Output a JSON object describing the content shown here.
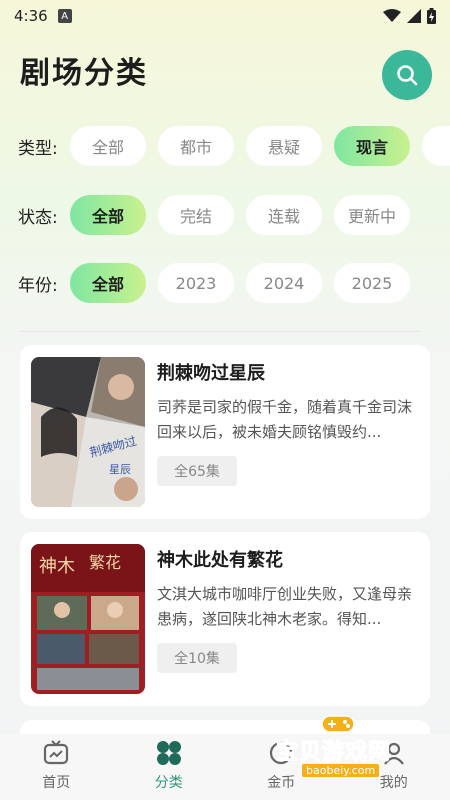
{
  "status_bar": {
    "time": "4:36",
    "badge": "A"
  },
  "header": {
    "title": "剧场分类"
  },
  "filters": {
    "type": {
      "label": "类型:",
      "options": [
        "全部",
        "都市",
        "悬疑",
        "现言"
      ],
      "selected": "现言"
    },
    "status": {
      "label": "状态:",
      "options": [
        "全部",
        "完结",
        "连载",
        "更新中"
      ],
      "selected": "全部"
    },
    "year": {
      "label": "年份:",
      "options": [
        "全部",
        "2023",
        "2024",
        "2025"
      ],
      "selected": "全部"
    }
  },
  "dramas": [
    {
      "title": "荆棘吻过星辰",
      "description": "司荞是司家的假千金，随着真千金司沫回来以后，被未婚夫顾铭慎毁约...",
      "episodes": "全65集"
    },
    {
      "title": "神木此处有繁花",
      "description": "文淇大城市咖啡厅创业失败，又逢母亲患病，遂回陕北神木老家。得知...",
      "episodes": "全10集"
    }
  ],
  "tabbar": {
    "items": [
      {
        "label": "首页",
        "icon": "tv-icon"
      },
      {
        "label": "分类",
        "icon": "grid-icon"
      },
      {
        "label": "金币",
        "icon": "coin-icon"
      },
      {
        "label": "我的",
        "icon": "user-icon"
      }
    ],
    "active": "分类"
  },
  "watermark": {
    "text": "宝贝游戏网",
    "url": "baobeiy.com"
  },
  "colors": {
    "accent": "#3bb79a",
    "chip_active_start": "#7fe6a1",
    "chip_active_end": "#c9f18e",
    "watermark": "#f6b017"
  }
}
